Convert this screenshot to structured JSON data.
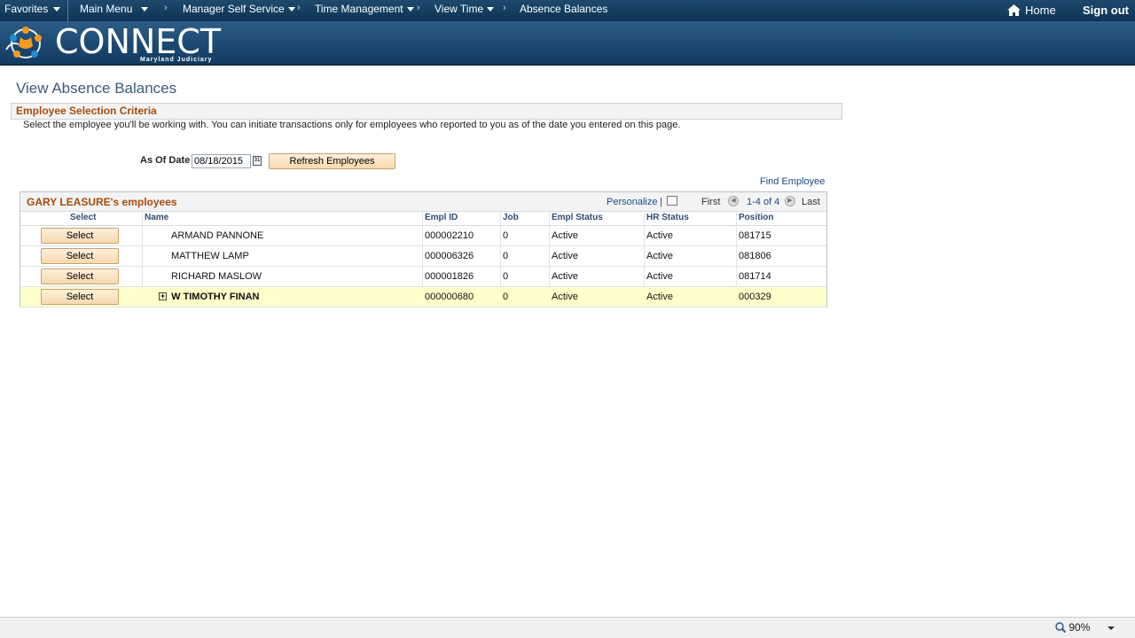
{
  "topnav": {
    "items": [
      {
        "label": "Favorites"
      },
      {
        "label": "Main Menu"
      },
      {
        "label": "Manager Self Service"
      },
      {
        "label": "Time Management"
      },
      {
        "label": "View Time"
      },
      {
        "label": "Absence Balances"
      }
    ],
    "home_label": "Home",
    "signout_label": "Sign out"
  },
  "banner": {
    "logo_text": "CONNECT",
    "logo_sub": "Maryland Judiciary"
  },
  "page": {
    "title": "View Absence Balances",
    "section_title": "Employee Selection Criteria",
    "instructions": "Select the employee you'll be working with. You can initiate transactions only for employees who reported to you as of the date you entered on this page.",
    "as_of_label": "As Of Date",
    "as_of_value": "08/18/2015",
    "refresh_label": "Refresh Employees",
    "find_employee_label": "Find Employee"
  },
  "grid": {
    "title": "GARY LEASURE's employees",
    "personalize_label": "Personalize",
    "pipe": "|",
    "first_label": "First",
    "range_label": "1-4 of 4",
    "last_label": "Last",
    "columns": [
      "Select",
      "Name",
      "Empl ID",
      "Job",
      "Empl Status",
      "HR Status",
      "Position"
    ],
    "select_label": "Select",
    "rows": [
      {
        "name": "ARMAND PANNONE",
        "empl_id": "000002210",
        "job": "0",
        "empl_status": "Active",
        "hr_status": "Active",
        "position": "081715"
      },
      {
        "name": "MATTHEW LAMP",
        "empl_id": "000006326",
        "job": "0",
        "empl_status": "Active",
        "hr_status": "Active",
        "position": "081806"
      },
      {
        "name": "RICHARD MASLOW",
        "empl_id": "000001826",
        "job": "0",
        "empl_status": "Active",
        "hr_status": "Active",
        "position": "081714"
      },
      {
        "name": "W TIMOTHY FINAN",
        "empl_id": "000000680",
        "job": "0",
        "empl_status": "Active",
        "hr_status": "Active",
        "position": "000329"
      }
    ]
  },
  "statusbar": {
    "zoom": "90%"
  }
}
